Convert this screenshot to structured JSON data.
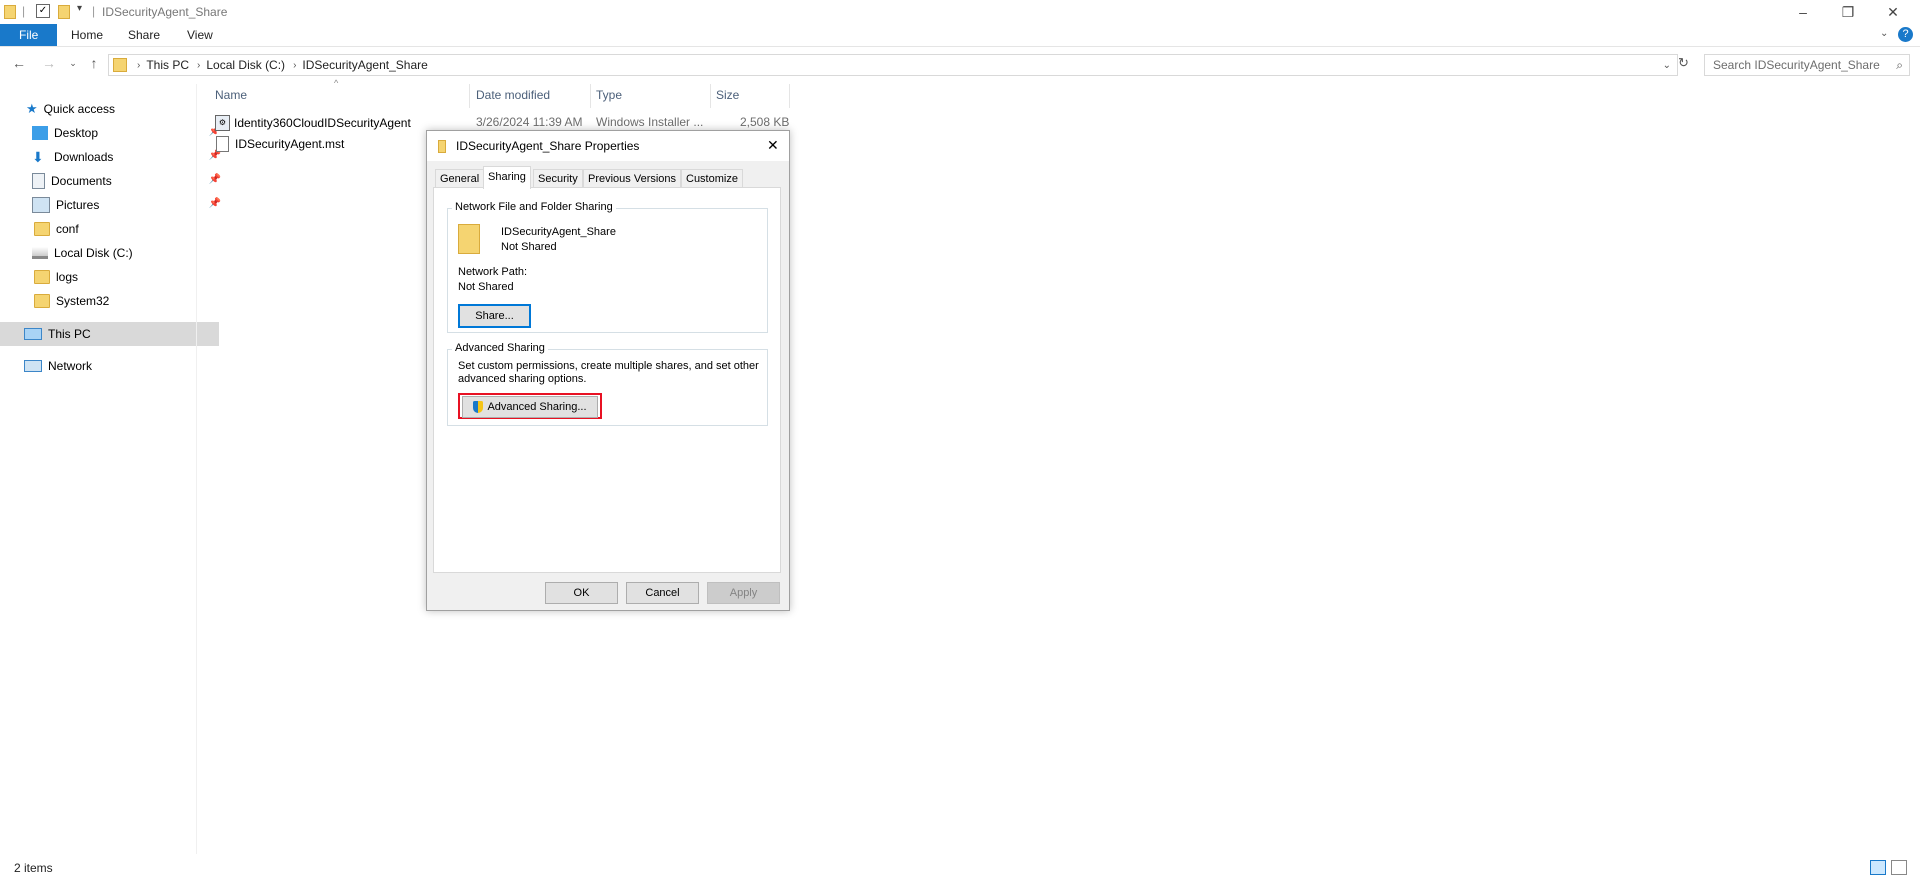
{
  "window": {
    "title": "IDSecurityAgent_Share",
    "controls": {
      "minimize": "–",
      "restore": "❐",
      "close": "✕"
    }
  },
  "ribbon": {
    "tabs": [
      "File",
      "Home",
      "Share",
      "View"
    ],
    "accent": "#1979ca"
  },
  "address": {
    "crumbs": [
      "This PC",
      "Local Disk (C:)",
      "IDSecurityAgent_Share"
    ],
    "search_placeholder": "Search IDSecurityAgent_Share"
  },
  "sidebar": {
    "quick_access": "Quick access",
    "items": [
      {
        "label": "Desktop",
        "icon": "desktop-icon",
        "pinned": true
      },
      {
        "label": "Downloads",
        "icon": "downloads-icon",
        "pinned": true
      },
      {
        "label": "Documents",
        "icon": "documents-icon",
        "pinned": true
      },
      {
        "label": "Pictures",
        "icon": "pictures-icon",
        "pinned": true
      },
      {
        "label": "conf",
        "icon": "folder-icon",
        "pinned": false
      },
      {
        "label": "Local Disk (C:)",
        "icon": "drive-icon",
        "pinned": false
      },
      {
        "label": "logs",
        "icon": "folder-icon",
        "pinned": false
      },
      {
        "label": "System32",
        "icon": "folder-icon",
        "pinned": false
      }
    ],
    "this_pc": "This PC",
    "network": "Network"
  },
  "file_list": {
    "columns": [
      "Name",
      "Date modified",
      "Type",
      "Size"
    ],
    "rows": [
      {
        "name": "Identity360CloudIDSecurityAgent",
        "date": "3/26/2024 11:39 AM",
        "type": "Windows Installer ...",
        "size": "2,508 KB",
        "icon": "installer-icon"
      },
      {
        "name": "IDSecurityAgent.mst",
        "date": "",
        "type": "",
        "size": "",
        "icon": "file-icon"
      }
    ]
  },
  "dialog": {
    "title": "IDSecurityAgent_Share Properties",
    "tabs": [
      "General",
      "Sharing",
      "Security",
      "Previous Versions",
      "Customize"
    ],
    "selected_tab": "Sharing",
    "network_sharing": {
      "group_label": "Network File and Folder Sharing",
      "folder_name": "IDSecurityAgent_Share",
      "share_state": "Not Shared",
      "path_label": "Network Path:",
      "path_value": "Not Shared",
      "share_button": "Share..."
    },
    "advanced_sharing": {
      "group_label": "Advanced Sharing",
      "description_line1": "Set custom permissions, create multiple shares, and set other",
      "description_line2": "advanced sharing options.",
      "button": "Advanced Sharing...",
      "highlight_color": "#e81123"
    },
    "buttons": {
      "ok": "OK",
      "cancel": "Cancel",
      "apply": "Apply"
    }
  },
  "status": {
    "item_count": "2 items"
  }
}
